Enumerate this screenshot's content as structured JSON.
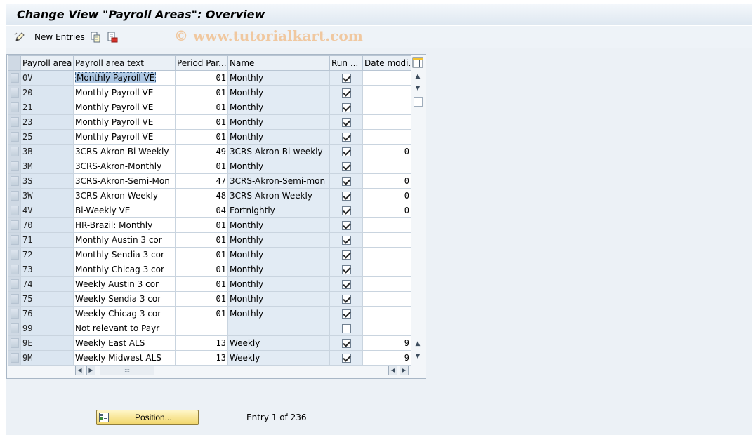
{
  "window": {
    "title": "Change View \"Payroll Areas\": Overview"
  },
  "toolbar": {
    "new_entries_label": "New Entries",
    "watermark": "© www.tutorialkart.com"
  },
  "table": {
    "columns": [
      "Payroll area",
      "Payroll area text",
      "Period Par...",
      "Name",
      "Run ...",
      "Date modi..."
    ],
    "rows": [
      {
        "area": "0V",
        "text": "Monthly Payroll  VE",
        "period": "01",
        "name": "Monthly",
        "run": true,
        "date": ""
      },
      {
        "area": "20",
        "text": "Monthly Payroll  VE",
        "period": "01",
        "name": "Monthly",
        "run": true,
        "date": ""
      },
      {
        "area": "21",
        "text": "Monthly Payroll  VE",
        "period": "01",
        "name": "Monthly",
        "run": true,
        "date": ""
      },
      {
        "area": "23",
        "text": "Monthly Payroll  VE",
        "period": "01",
        "name": "Monthly",
        "run": true,
        "date": ""
      },
      {
        "area": "25",
        "text": "Monthly Payroll  VE",
        "period": "01",
        "name": "Monthly",
        "run": true,
        "date": ""
      },
      {
        "area": "3B",
        "text": "3CRS-Akron-Bi-Weekly",
        "period": "49",
        "name": "3CRS-Akron-Bi-weekly",
        "run": true,
        "date": "0"
      },
      {
        "area": "3M",
        "text": "3CRS-Akron-Monthly",
        "period": "01",
        "name": "Monthly",
        "run": true,
        "date": ""
      },
      {
        "area": "3S",
        "text": "3CRS-Akron-Semi-Mon",
        "period": "47",
        "name": "3CRS-Akron-Semi-mon",
        "run": true,
        "date": "0"
      },
      {
        "area": "3W",
        "text": "3CRS-Akron-Weekly",
        "period": "48",
        "name": "3CRS-Akron-Weekly",
        "run": true,
        "date": "0"
      },
      {
        "area": "4V",
        "text": "Bi-Weekly VE",
        "period": "04",
        "name": "Fortnightly",
        "run": true,
        "date": "0"
      },
      {
        "area": "70",
        "text": "HR-Brazil: Monthly",
        "period": "01",
        "name": "Monthly",
        "run": true,
        "date": ""
      },
      {
        "area": "71",
        "text": "Monthly Austin 3 cor",
        "period": "01",
        "name": "Monthly",
        "run": true,
        "date": ""
      },
      {
        "area": "72",
        "text": "Monthly Sendia 3 cor",
        "period": "01",
        "name": "Monthly",
        "run": true,
        "date": ""
      },
      {
        "area": "73",
        "text": "Monthly Chicag 3 cor",
        "period": "01",
        "name": "Monthly",
        "run": true,
        "date": ""
      },
      {
        "area": "74",
        "text": "Weekly Austin 3 cor",
        "period": "01",
        "name": "Monthly",
        "run": true,
        "date": ""
      },
      {
        "area": "75",
        "text": "Weekly Sendia 3 cor",
        "period": "01",
        "name": "Monthly",
        "run": true,
        "date": ""
      },
      {
        "area": "76",
        "text": "Weekly Chicag 3 cor",
        "period": "01",
        "name": "Monthly",
        "run": true,
        "date": ""
      },
      {
        "area": "99",
        "text": "Not relevant to Payr",
        "period": "",
        "name": "",
        "run": false,
        "date": ""
      },
      {
        "area": "9E",
        "text": "Weekly East ALS",
        "period": "13",
        "name": "Weekly",
        "run": true,
        "date": "9"
      },
      {
        "area": "9M",
        "text": "Weekly Midwest ALS",
        "period": "13",
        "name": "Weekly",
        "run": true,
        "date": "9"
      }
    ]
  },
  "footer": {
    "position_label": "Position...",
    "entry_info": "Entry 1 of 236"
  },
  "icons": {
    "toolbar": [
      "edit-pencil-icon",
      "copy-icon",
      "delete-icon"
    ],
    "table": [
      "column-settings-icon",
      "scroll-up-icon",
      "scroll-down-icon",
      "scroll-left-icon",
      "scroll-right-icon"
    ],
    "footer": [
      "position-icon"
    ]
  },
  "colors": {
    "key_cell": "#dbe6f1",
    "selection": "#aec8e4",
    "position_button": "#f1d66a"
  }
}
